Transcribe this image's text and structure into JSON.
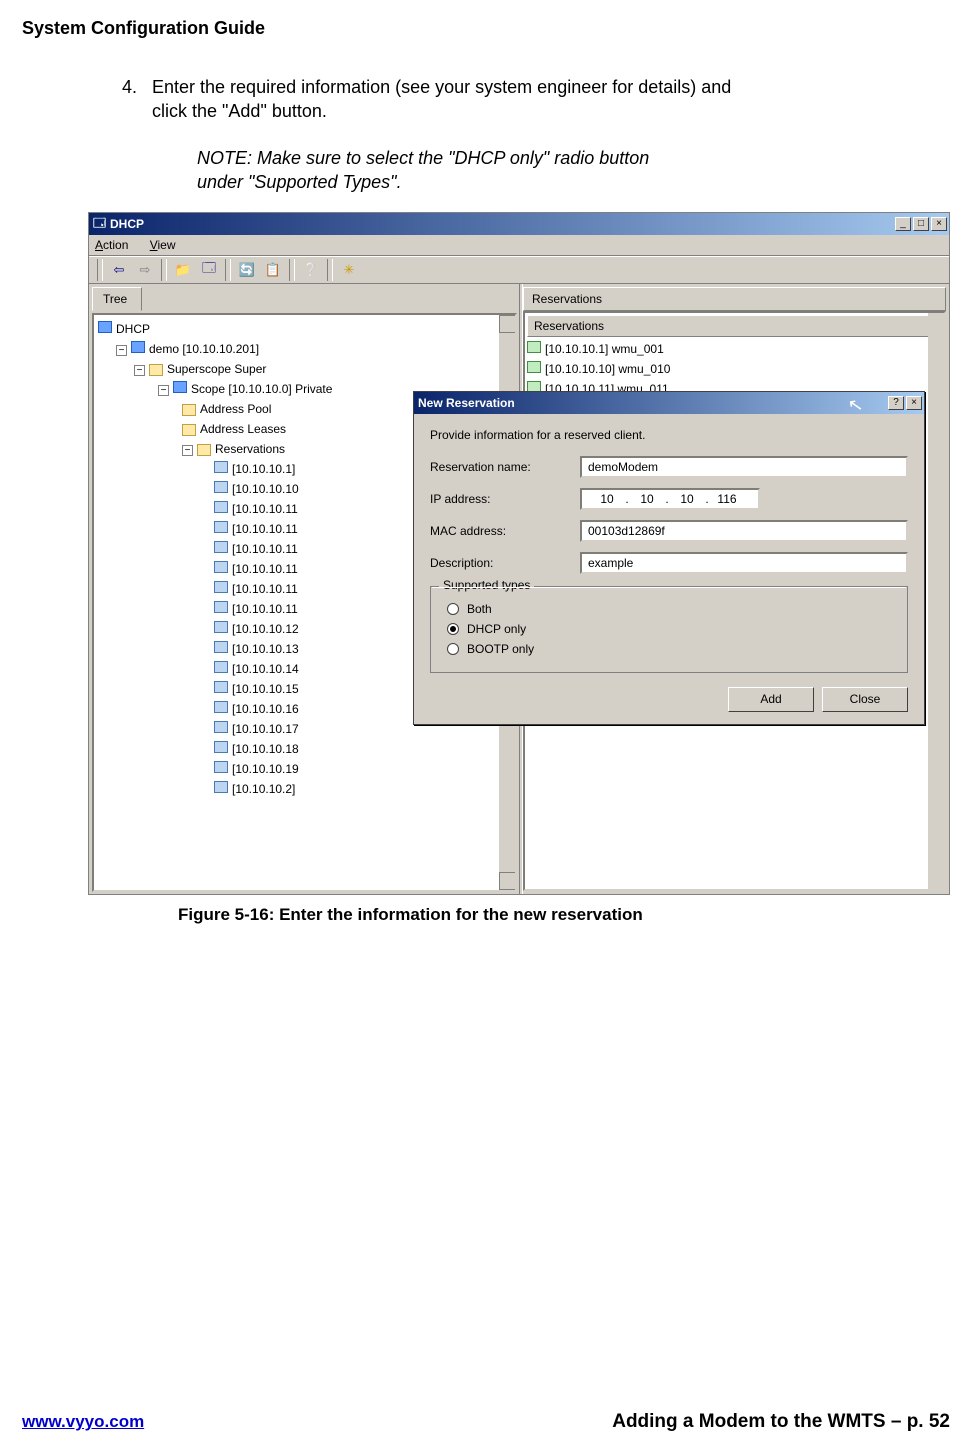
{
  "doc": {
    "title": "System Configuration Guide",
    "step_number": "4.",
    "step_text_a": "Enter the required information (see your system engineer for details) and",
    "step_text_b": "click the \"Add\" button.",
    "note_a": "NOTE: Make sure to select the \"DHCP only\" radio button",
    "note_b": "under  \"Supported Types\".",
    "figure_caption": "Figure 5-16: Enter the information for the new reservation",
    "footer_url": "www.vyyo.com",
    "footer_section": "Adding a Modem to the WMTS – p. 52"
  },
  "mmc": {
    "title": "DHCP",
    "menu_action": "Action",
    "menu_view": "View",
    "tree_tab": "Tree",
    "right_header": "Reservations",
    "right_header2": "Reservations",
    "tree": {
      "root": "DHCP",
      "server": "demo [10.10.10.201]",
      "superscope": "Superscope Super",
      "scope": "Scope [10.10.10.0] Private",
      "pool": "Address Pool",
      "leases": "Address Leases",
      "reservations": "Reservations",
      "items": [
        "[10.10.10.1]",
        "[10.10.10.10",
        "[10.10.10.11",
        "[10.10.10.11",
        "[10.10.10.11",
        "[10.10.10.11",
        "[10.10.10.11",
        "[10.10.10.11",
        "[10.10.10.12",
        "[10.10.10.13",
        "[10.10.10.14",
        "[10.10.10.15",
        "[10.10.10.16",
        "[10.10.10.17",
        "[10.10.10.18",
        "[10.10.10.19",
        "[10.10.10.2]"
      ]
    },
    "list": [
      "[10.10.10.1] wmu_001",
      "[10.10.10.10] wmu_010",
      "[10.10.10.11] wmu_011"
    ]
  },
  "dlg": {
    "title": "New Reservation",
    "intro": "Provide information for a reserved client.",
    "lbl_name": "Reservation name:",
    "lbl_ip": "IP address:",
    "lbl_mac": "MAC address:",
    "lbl_desc": "Description:",
    "val_name": "demoModem",
    "ip_a": "10",
    "ip_b": "10",
    "ip_c": "10",
    "ip_d": "116",
    "val_mac": "00103d12869f",
    "val_desc": "example",
    "legend": "Supported types",
    "opt_both": "Both",
    "opt_dhcp": "DHCP only",
    "opt_bootp": "BOOTP only",
    "btn_add": "Add",
    "btn_close": "Close"
  }
}
